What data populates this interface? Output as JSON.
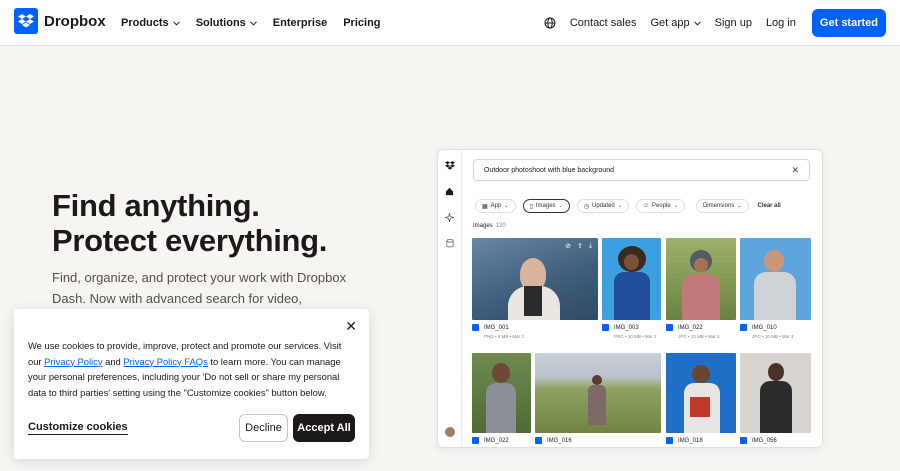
{
  "nav": {
    "brand": "Dropbox",
    "links": [
      {
        "label": "Products",
        "has_menu": true
      },
      {
        "label": "Solutions",
        "has_menu": true
      },
      {
        "label": "Enterprise",
        "has_menu": false
      },
      {
        "label": "Pricing",
        "has_menu": false
      }
    ],
    "right": {
      "language_icon": "globe-icon",
      "contact_sales": "Contact sales",
      "get_app": "Get app",
      "sign_up": "Sign up",
      "log_in": "Log in",
      "get_started": "Get started"
    },
    "accent_color": "#0061fe"
  },
  "hero": {
    "title_line1": "Find anything.",
    "title_line2": "Protect everything.",
    "subtitle": "Find, organize, and protect your work with Dropbox Dash. Now with advanced search for video,"
  },
  "mock": {
    "search_value": "Outdoor photoshoot with blue background",
    "filters": [
      {
        "label": "App",
        "icon": "grid-icon"
      },
      {
        "label": "Images",
        "icon": "image-icon",
        "active": true
      },
      {
        "label": "Updated",
        "icon": "clock-icon"
      },
      {
        "label": "People",
        "icon": "people-icon"
      },
      {
        "label": "Dimensions",
        "icon": ""
      }
    ],
    "clear_all": "Clear all",
    "section_label": "Images",
    "section_count": "120",
    "tiles": [
      {
        "name": "IMG_001",
        "meta": "PNG • 8 MB • Mar 2"
      },
      {
        "name": "IMG_003",
        "meta": "PNG • 10 MB • Mar 2"
      },
      {
        "name": "IMG_022",
        "meta": "JPG • 10 MB • Mar 3"
      },
      {
        "name": "IMG_010",
        "meta": "JPG • 10 MB • Mar 3"
      },
      {
        "name": "IMG_022",
        "meta": ""
      },
      {
        "name": "IMG_016",
        "meta": ""
      },
      {
        "name": "IMG_018",
        "meta": ""
      },
      {
        "name": "IMG_056",
        "meta": ""
      }
    ]
  },
  "cookie": {
    "text_1": "We use cookies to provide, improve, protect and promote our services. Visit our ",
    "privacy_policy": "Privacy Policy",
    "text_2": " and ",
    "privacy_faqs": "Privacy Policy FAQs",
    "text_3": " to learn more. You can manage your personal preferences, including your 'Do not sell or share my personal data to third parties' setting using the \"Customize cookies\" button below.",
    "customize": "Customize cookies",
    "decline": "Decline",
    "accept": "Accept All",
    "close_icon": "close-icon"
  }
}
